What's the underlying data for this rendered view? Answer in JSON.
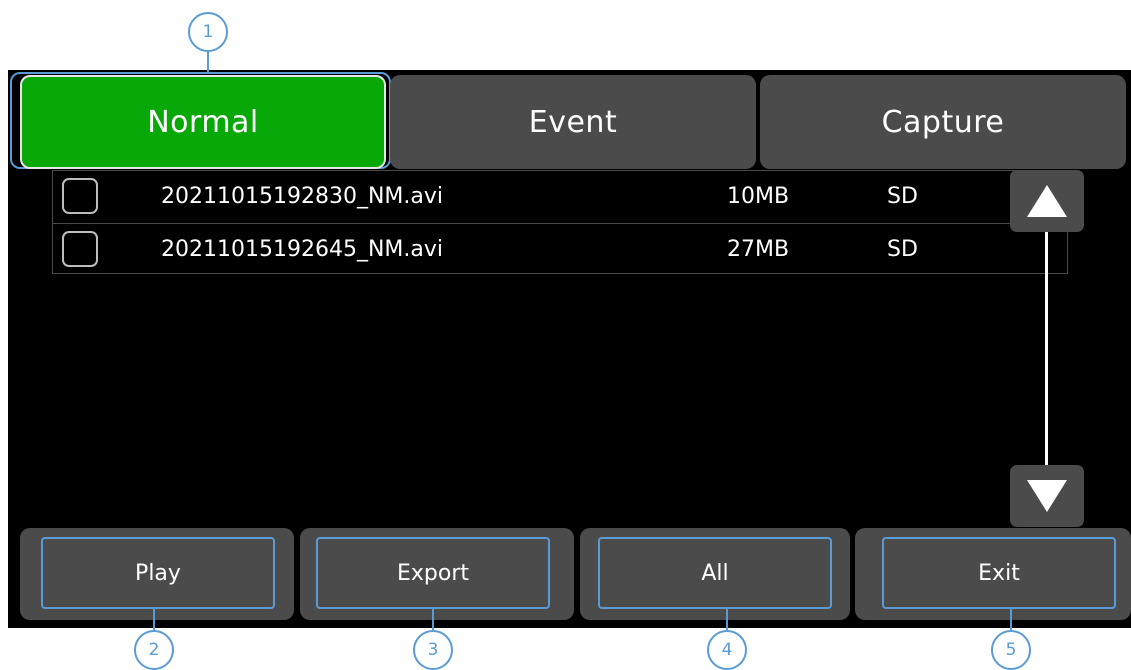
{
  "tabs": [
    {
      "label": "Normal",
      "active": true
    },
    {
      "label": "Event",
      "active": false
    },
    {
      "label": "Capture",
      "active": false
    }
  ],
  "files": [
    {
      "name": "20211015192830_NM.avi",
      "size": "10MB",
      "storage": "SD",
      "checked": false
    },
    {
      "name": "20211015192645_NM.avi",
      "size": "27MB",
      "storage": "SD",
      "checked": false
    }
  ],
  "buttons": {
    "play": "Play",
    "export": "Export",
    "all": "All",
    "exit": "Exit"
  },
  "callouts": [
    "1",
    "2",
    "3",
    "4",
    "5"
  ],
  "scroll": {
    "up_icon": "triangle-up",
    "down_icon": "triangle-down"
  },
  "colors": {
    "active_tab": "#07a807",
    "panel": "#4b4b4b",
    "screen_bg": "#000000",
    "callout": "#5b9bd5"
  }
}
